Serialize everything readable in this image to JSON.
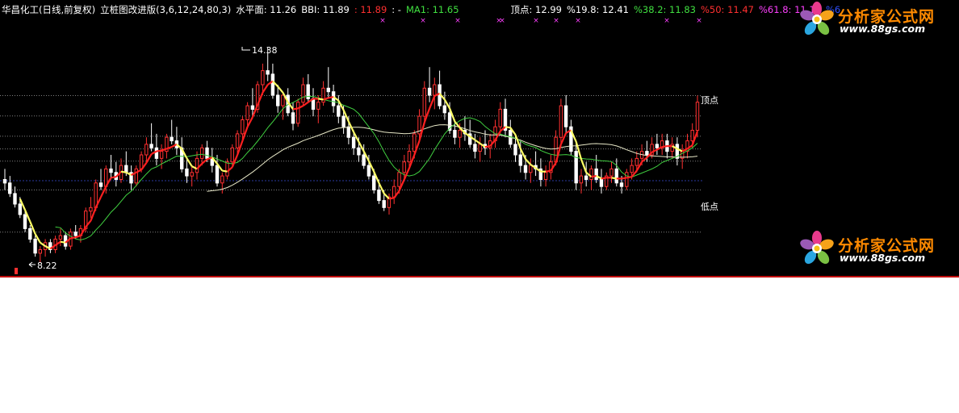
{
  "info": {
    "title": "华昌化工(日线,前复权)",
    "indicator": "立桩图改进版(3,6,12,24,80,3)",
    "level": "水平面: 11.26",
    "bbi": "BBI: 11.89",
    "bbi2": ": 11.89",
    "dash": ": -",
    "ma1": "MA1: 11.65",
    "top": "顶点: 12.99",
    "fib198": "%19.8: 12.41",
    "fib382": "%38.2: 11.83",
    "fib50": "%50: 11.47",
    "fib618": "%61.8: 11.12",
    "fibcut": "%6"
  },
  "colors": {
    "bg": "#000000",
    "up": "#ff3030",
    "down": "#ffffff",
    "yellow": "#ffff66",
    "red_line": "#ff2020",
    "green_line": "#40d040",
    "slow_line": "#e8e8c8",
    "blue": "#2040ff",
    "magenta": "#ff40ff",
    "hline": "#808080"
  },
  "annotations": {
    "high_label": "14.38",
    "low_label": "8.22",
    "top_label": "顶点",
    "bottom_label": "低点"
  },
  "logo": {
    "brand": "分析家公式网",
    "url": "www.88gs.com"
  },
  "chart_data": {
    "type": "candlestick",
    "title": "华昌化工(日线,前复权)",
    "high_value": 14.38,
    "low_value": 8.22,
    "levels": [
      12.99,
      12.41,
      11.83,
      11.47,
      11.12,
      10.3,
      9.1
    ],
    "top_value": 12.99,
    "candles": [
      [
        10.6,
        10.9,
        10.3,
        10.5
      ],
      [
        10.5,
        10.7,
        10.1,
        10.2
      ],
      [
        10.2,
        10.4,
        9.8,
        9.9
      ],
      [
        9.9,
        10.1,
        9.5,
        9.6
      ],
      [
        9.6,
        9.7,
        9.1,
        9.2
      ],
      [
        9.2,
        9.3,
        8.8,
        8.9
      ],
      [
        8.9,
        9.0,
        8.4,
        8.5
      ],
      [
        8.5,
        8.7,
        8.22,
        8.6
      ],
      [
        8.6,
        8.9,
        8.4,
        8.8
      ],
      [
        8.8,
        8.9,
        8.5,
        8.6
      ],
      [
        8.6,
        9.0,
        8.5,
        8.9
      ],
      [
        8.9,
        9.2,
        8.7,
        9.0
      ],
      [
        9.0,
        9.1,
        8.6,
        8.7
      ],
      [
        8.7,
        9.2,
        8.6,
        9.1
      ],
      [
        9.1,
        9.3,
        8.9,
        9.0
      ],
      [
        9.0,
        9.3,
        8.8,
        9.2
      ],
      [
        9.2,
        9.8,
        9.1,
        9.7
      ],
      [
        9.7,
        10.1,
        9.5,
        9.8
      ],
      [
        9.8,
        10.6,
        9.7,
        10.5
      ],
      [
        10.5,
        10.9,
        10.3,
        10.4
      ],
      [
        10.4,
        11.0,
        10.2,
        10.9
      ],
      [
        10.9,
        11.3,
        10.6,
        10.8
      ],
      [
        10.8,
        11.1,
        10.4,
        10.6
      ],
      [
        10.6,
        11.2,
        10.5,
        11.0
      ],
      [
        11.0,
        11.4,
        10.7,
        10.8
      ],
      [
        10.8,
        11.0,
        10.3,
        10.5
      ],
      [
        10.5,
        11.0,
        10.4,
        10.9
      ],
      [
        10.9,
        11.4,
        10.8,
        11.3
      ],
      [
        11.3,
        11.8,
        11.1,
        11.6
      ],
      [
        11.6,
        12.2,
        11.4,
        11.5
      ],
      [
        11.5,
        11.9,
        11.0,
        11.2
      ],
      [
        11.2,
        11.6,
        10.9,
        11.4
      ],
      [
        11.4,
        11.9,
        11.2,
        11.8
      ],
      [
        11.8,
        12.3,
        11.6,
        11.7
      ],
      [
        11.7,
        12.1,
        11.3,
        11.5
      ],
      [
        11.5,
        11.8,
        10.8,
        10.9
      ],
      [
        10.9,
        11.2,
        10.5,
        10.7
      ],
      [
        10.7,
        11.0,
        10.4,
        10.8
      ],
      [
        10.8,
        11.4,
        10.6,
        11.2
      ],
      [
        11.2,
        11.6,
        11.0,
        11.5
      ],
      [
        11.5,
        11.7,
        11.1,
        11.2
      ],
      [
        11.2,
        11.5,
        10.8,
        11.0
      ],
      [
        11.0,
        11.3,
        10.4,
        10.5
      ],
      [
        10.5,
        10.8,
        10.2,
        10.7
      ],
      [
        10.7,
        11.2,
        10.6,
        11.1
      ],
      [
        11.1,
        11.6,
        11.0,
        11.5
      ],
      [
        11.5,
        12.0,
        11.3,
        11.9
      ],
      [
        11.9,
        12.4,
        11.7,
        12.3
      ],
      [
        12.3,
        12.8,
        12.1,
        12.7
      ],
      [
        12.7,
        13.2,
        12.4,
        12.6
      ],
      [
        12.6,
        13.4,
        12.5,
        13.3
      ],
      [
        13.3,
        13.9,
        13.0,
        13.7
      ],
      [
        13.7,
        14.38,
        13.4,
        13.6
      ],
      [
        13.6,
        13.9,
        12.9,
        13.0
      ],
      [
        13.0,
        13.3,
        12.5,
        12.7
      ],
      [
        12.7,
        13.1,
        12.3,
        13.0
      ],
      [
        13.0,
        13.2,
        12.4,
        12.5
      ],
      [
        12.5,
        12.8,
        12.0,
        12.2
      ],
      [
        12.2,
        12.9,
        12.1,
        12.8
      ],
      [
        12.8,
        13.5,
        12.7,
        13.3
      ],
      [
        13.3,
        13.6,
        12.8,
        12.9
      ],
      [
        12.9,
        13.2,
        12.4,
        12.6
      ],
      [
        12.6,
        13.0,
        12.2,
        12.8
      ],
      [
        12.8,
        13.4,
        12.7,
        13.2
      ],
      [
        13.2,
        13.8,
        12.9,
        13.1
      ],
      [
        13.1,
        13.3,
        12.5,
        12.7
      ],
      [
        12.7,
        13.0,
        12.2,
        12.4
      ],
      [
        12.4,
        12.7,
        11.9,
        12.1
      ],
      [
        12.1,
        12.4,
        11.6,
        11.8
      ],
      [
        11.8,
        12.0,
        11.3,
        11.5
      ],
      [
        11.5,
        11.8,
        11.1,
        11.3
      ],
      [
        11.3,
        11.6,
        10.9,
        11.0
      ],
      [
        11.0,
        11.3,
        10.6,
        10.7
      ],
      [
        10.7,
        10.9,
        10.2,
        10.3
      ],
      [
        10.3,
        10.6,
        9.9,
        10.0
      ],
      [
        10.0,
        10.3,
        9.7,
        9.8
      ],
      [
        9.8,
        10.2,
        9.6,
        10.1
      ],
      [
        10.1,
        10.6,
        9.9,
        10.4
      ],
      [
        10.4,
        10.9,
        10.2,
        10.8
      ],
      [
        10.8,
        11.3,
        10.6,
        11.1
      ],
      [
        11.1,
        11.6,
        10.9,
        11.4
      ],
      [
        11.4,
        12.0,
        11.2,
        11.9
      ],
      [
        11.9,
        12.6,
        11.7,
        12.4
      ],
      [
        12.4,
        13.4,
        12.2,
        13.2
      ],
      [
        13.2,
        13.8,
        12.8,
        13.0
      ],
      [
        13.0,
        13.5,
        12.6,
        13.3
      ],
      [
        13.3,
        13.7,
        12.6,
        12.7
      ],
      [
        12.7,
        13.1,
        12.3,
        12.5
      ],
      [
        12.5,
        12.8,
        11.9,
        12.0
      ],
      [
        12.0,
        12.3,
        11.6,
        11.8
      ],
      [
        11.8,
        12.2,
        11.5,
        12.0
      ],
      [
        12.0,
        12.4,
        11.7,
        11.9
      ],
      [
        11.9,
        12.3,
        11.5,
        11.6
      ],
      [
        11.6,
        11.9,
        11.2,
        11.4
      ],
      [
        11.4,
        11.8,
        11.1,
        11.6
      ],
      [
        11.6,
        12.0,
        11.3,
        11.5
      ],
      [
        11.5,
        11.9,
        11.2,
        11.7
      ],
      [
        11.7,
        12.3,
        11.5,
        12.1
      ],
      [
        12.1,
        12.8,
        11.9,
        12.6
      ],
      [
        12.6,
        12.9,
        11.8,
        12.0
      ],
      [
        12.0,
        12.3,
        11.5,
        11.6
      ],
      [
        11.6,
        11.9,
        11.1,
        11.3
      ],
      [
        11.3,
        11.7,
        10.8,
        11.0
      ],
      [
        11.0,
        11.3,
        10.6,
        10.8
      ],
      [
        10.8,
        11.2,
        10.5,
        11.0
      ],
      [
        11.0,
        11.4,
        10.7,
        10.9
      ],
      [
        10.9,
        11.2,
        10.4,
        10.6
      ],
      [
        10.6,
        11.0,
        10.4,
        10.8
      ],
      [
        10.8,
        11.3,
        10.6,
        11.1
      ],
      [
        11.1,
        12.0,
        11.0,
        11.8
      ],
      [
        11.8,
        12.9,
        11.6,
        12.7
      ],
      [
        12.7,
        13.0,
        11.9,
        12.1
      ],
      [
        12.1,
        12.3,
        11.3,
        11.4
      ],
      [
        11.4,
        11.7,
        10.3,
        10.5
      ],
      [
        10.5,
        10.9,
        10.2,
        10.7
      ],
      [
        10.7,
        11.1,
        10.4,
        10.6
      ],
      [
        10.6,
        11.0,
        10.3,
        10.9
      ],
      [
        10.9,
        11.3,
        10.5,
        10.6
      ],
      [
        10.6,
        10.9,
        10.2,
        10.4
      ],
      [
        10.4,
        10.8,
        10.3,
        10.7
      ],
      [
        10.7,
        11.1,
        10.5,
        10.9
      ],
      [
        10.9,
        11.2,
        10.4,
        10.5
      ],
      [
        10.5,
        10.7,
        10.2,
        10.4
      ],
      [
        10.4,
        10.9,
        10.3,
        10.8
      ],
      [
        10.8,
        11.2,
        10.6,
        11.0
      ],
      [
        11.0,
        11.4,
        10.8,
        11.2
      ],
      [
        11.2,
        11.6,
        11.0,
        11.4
      ],
      [
        11.4,
        11.7,
        11.1,
        11.3
      ],
      [
        11.3,
        11.8,
        11.2,
        11.6
      ],
      [
        11.6,
        11.9,
        11.3,
        11.5
      ],
      [
        11.5,
        11.9,
        11.3,
        11.7
      ],
      [
        11.7,
        11.9,
        11.2,
        11.4
      ],
      [
        11.4,
        11.8,
        11.2,
        11.6
      ],
      [
        11.6,
        11.8,
        11.0,
        11.2
      ],
      [
        11.2,
        11.6,
        10.9,
        11.4
      ],
      [
        11.4,
        11.9,
        11.2,
        11.7
      ],
      [
        11.7,
        12.2,
        11.5,
        12.0
      ],
      [
        12.0,
        12.99,
        11.8,
        12.8
      ]
    ]
  }
}
